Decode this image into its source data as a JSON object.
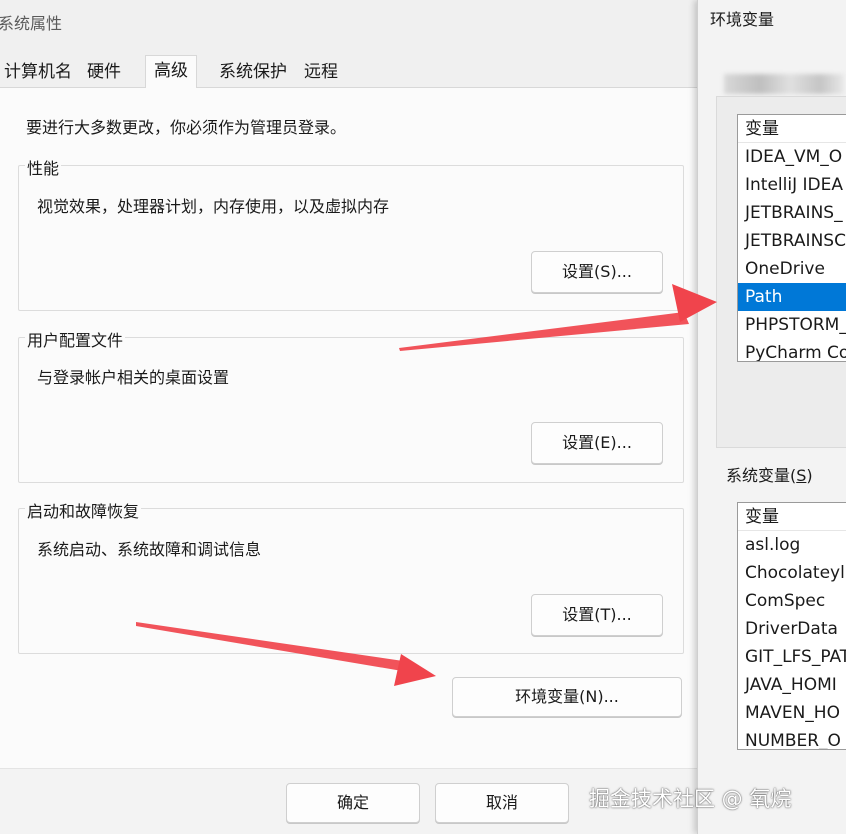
{
  "system_properties": {
    "window_title": "系统属性",
    "tabs": [
      {
        "label": "计算机名"
      },
      {
        "label": "硬件"
      },
      {
        "label": "高级",
        "active": true
      },
      {
        "label": "系统保护"
      },
      {
        "label": "远程"
      }
    ],
    "admin_note": "要进行大多数更改，你必须作为管理员登录。",
    "performance": {
      "title": "性能",
      "description": "视觉效果，处理器计划，内存使用，以及虚拟内存",
      "settings_button": "设置(S)..."
    },
    "user_profiles": {
      "title": "用户配置文件",
      "description": "与登录帐户相关的桌面设置",
      "settings_button": "设置(E)..."
    },
    "startup_recovery": {
      "title": "启动和故障恢复",
      "description": "系统启动、系统故障和调试信息",
      "settings_button": "设置(T)..."
    },
    "env_vars_button": "环境变量(N)...",
    "ok_button": "确定",
    "cancel_button": "取消"
  },
  "environment_variables": {
    "window_title": "环境变量",
    "user_vars": {
      "header": "变量",
      "rows": [
        "IDEA_VM_O",
        "IntelliJ IDEA",
        "JETBRAINS_",
        "JETBRAINSC",
        "OneDrive",
        "Path",
        "PHPSTORM_",
        "PyCharm Co"
      ],
      "selected": "Path"
    },
    "system_vars": {
      "label": "系统变量(",
      "label_key": "S",
      "label_end": ")",
      "header": "变量",
      "rows": [
        "asl.log",
        "Chocolateyl",
        "ComSpec",
        "DriverData",
        "GIT_LFS_PAT",
        "JAVA_HOMI",
        "MAVEN_HO",
        "NUMBER_O"
      ]
    }
  },
  "watermark": "掘金技术社区 @ 氧烷",
  "colors": {
    "selection": "#0078d7",
    "arrow": "#f0444c"
  }
}
